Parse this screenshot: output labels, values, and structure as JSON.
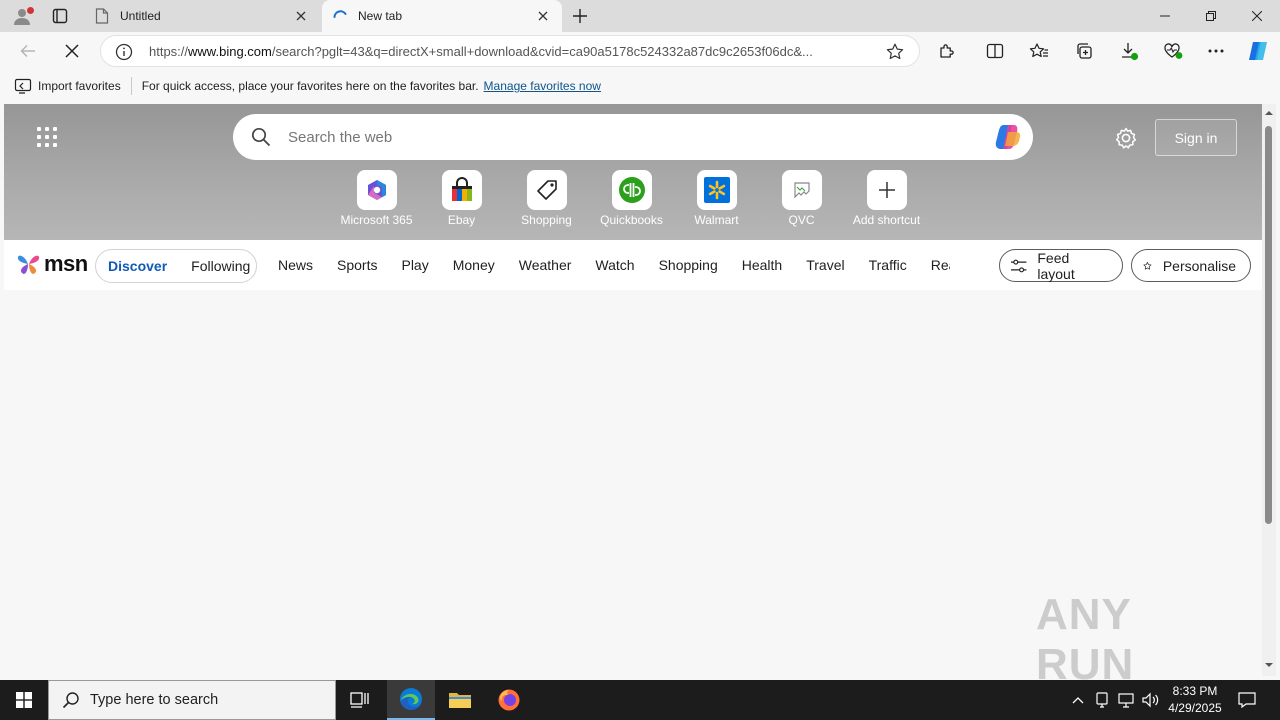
{
  "browser": {
    "tabs": [
      {
        "title": "Untitled",
        "active": false
      },
      {
        "title": "New tab",
        "active": true
      }
    ],
    "address": {
      "url_prefix": "https://",
      "url_domain": "www.bing.com",
      "url_rest": "/search?pglt=43&q=directX+small+download&cvid=ca90a5178c524332a87dc9c2653f06dc&..."
    },
    "favorites_bar": {
      "import_label": "Import favorites",
      "message": "For quick access, place your favorites here on the favorites bar.",
      "manage_link": "Manage favorites now"
    }
  },
  "new_tab": {
    "search_placeholder": "Search the web",
    "sign_in_label": "Sign in",
    "shortcuts": [
      {
        "label": "Microsoft 365",
        "icon": "microsoft-365-icon"
      },
      {
        "label": "Ebay",
        "icon": "ebay-icon"
      },
      {
        "label": "Shopping",
        "icon": "shopping-tag-icon"
      },
      {
        "label": "Quickbooks",
        "icon": "quickbooks-icon"
      },
      {
        "label": "Walmart",
        "icon": "walmart-icon"
      },
      {
        "label": "QVC",
        "icon": "broken-image-icon"
      },
      {
        "label": "Add shortcut",
        "icon": "plus-icon"
      }
    ]
  },
  "msn": {
    "logo_text": "msn",
    "pills": [
      {
        "label": "Discover",
        "active": true
      },
      {
        "label": "Following",
        "active": false
      }
    ],
    "nav": [
      "News",
      "Sports",
      "Play",
      "Money",
      "Weather",
      "Watch",
      "Shopping",
      "Health",
      "Travel",
      "Traffic",
      "Real E"
    ],
    "feed_layout_label": "Feed layout",
    "personalise_label": "Personalise"
  },
  "watermark": "ANY RUN",
  "taskbar": {
    "search_placeholder": "Type here to search",
    "time": "8:33 PM",
    "date": "4/29/2025"
  },
  "colors": {
    "accent": "#0f5bb5",
    "link": "#0f548c",
    "taskbar": "#1c1c1c"
  }
}
